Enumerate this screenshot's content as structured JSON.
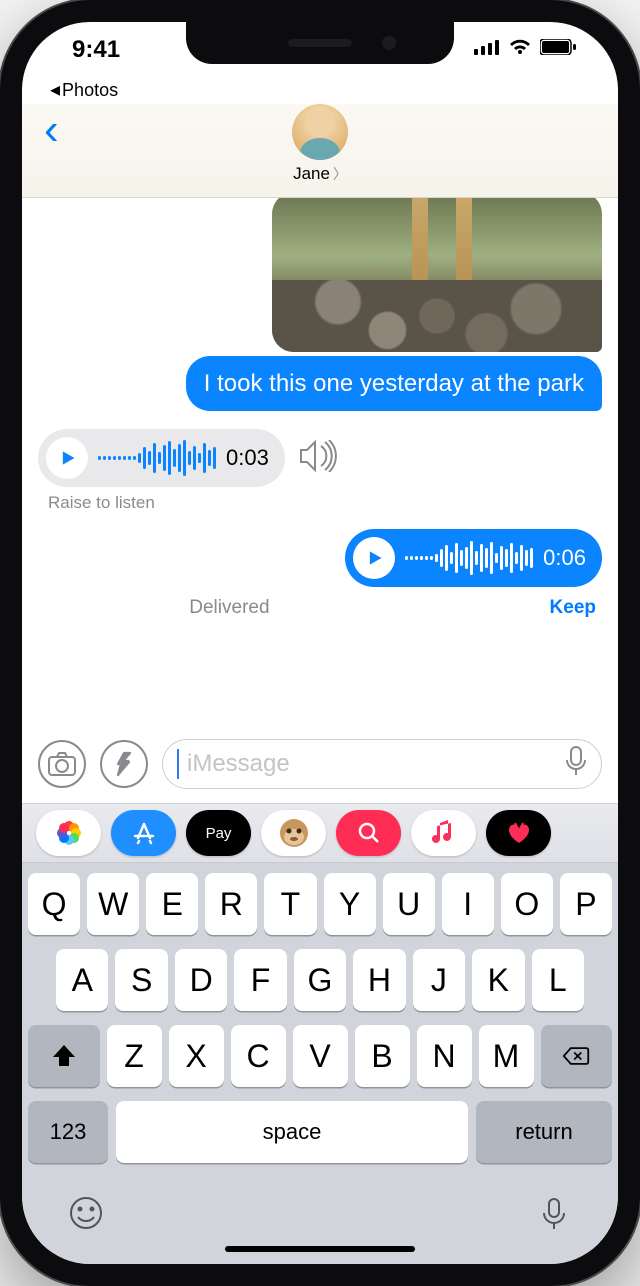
{
  "status": {
    "time": "9:41",
    "breadcrumb_app": "Photos"
  },
  "contact": {
    "name": "Jane"
  },
  "messages": {
    "sent_text": "I took this one yesterday at the park",
    "audio_recv": {
      "duration": "0:03",
      "hint": "Raise to listen"
    },
    "audio_sent": {
      "duration": "0:06",
      "status": "Delivered",
      "keep": "Keep"
    }
  },
  "compose": {
    "placeholder": "iMessage"
  },
  "apps": [
    "photos",
    "appstore",
    "applepay",
    "memoji",
    "search",
    "music",
    "digitaltouch"
  ],
  "keyboard": {
    "row1": [
      "Q",
      "W",
      "E",
      "R",
      "T",
      "Y",
      "U",
      "I",
      "O",
      "P"
    ],
    "row2": [
      "A",
      "S",
      "D",
      "F",
      "G",
      "H",
      "J",
      "K",
      "L"
    ],
    "row3": [
      "Z",
      "X",
      "C",
      "V",
      "B",
      "N",
      "M"
    ],
    "numkey": "123",
    "space": "space",
    "ret": "return"
  }
}
